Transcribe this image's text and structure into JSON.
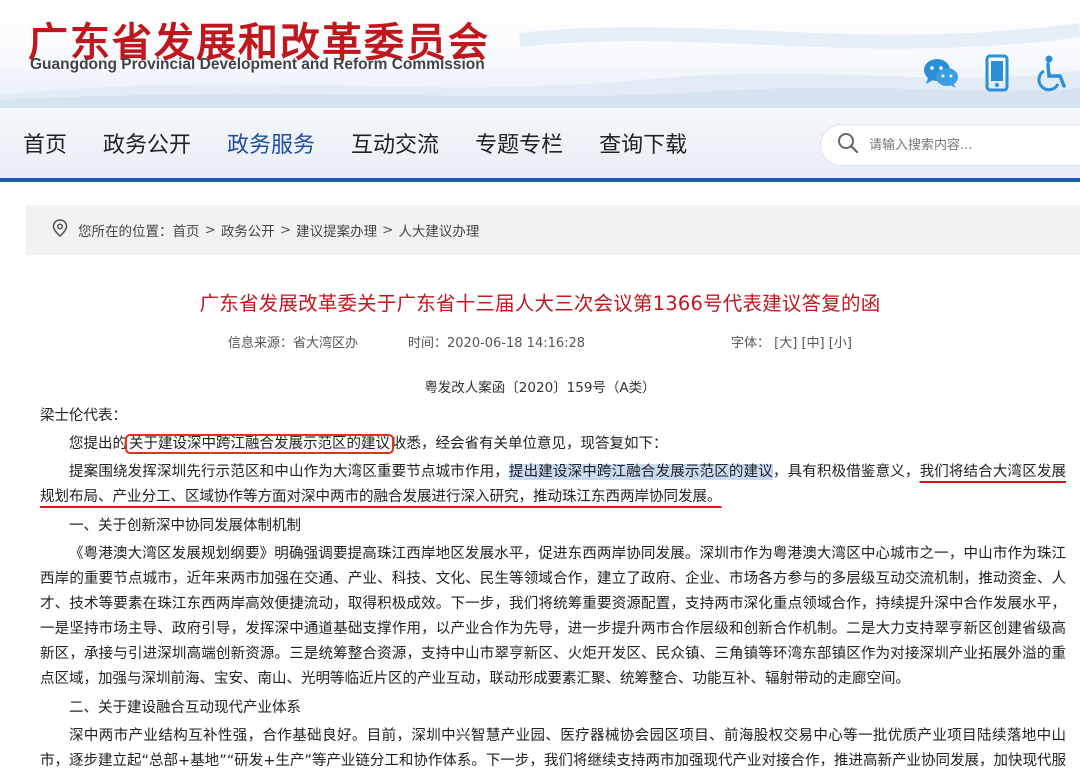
{
  "header": {
    "title": "广东省发展和改革委员会",
    "subtitle": "Guangdong Provincial Development and Reform Commission",
    "tools": [
      "wechat-icon",
      "mobile-icon",
      "accessibility-icon"
    ]
  },
  "nav": {
    "items": [
      {
        "label": "首页",
        "active": false
      },
      {
        "label": "政务公开",
        "active": false
      },
      {
        "label": "政务服务",
        "active": true
      },
      {
        "label": "互动交流",
        "active": false
      },
      {
        "label": "专题专栏",
        "active": false
      },
      {
        "label": "查询下载",
        "active": false
      }
    ],
    "search_placeholder": "请输入搜索内容..."
  },
  "breadcrumb": {
    "prefix": "您所在的位置：",
    "items": [
      "首页",
      "政务公开",
      "建议提案办理",
      "人大建议办理"
    ],
    "separator": ">"
  },
  "article": {
    "title": "广东省发展改革委关于广东省十三届人大三次会议第1366号代表建议答复的函",
    "source": "信息来源：省大湾区办",
    "time": "时间：2020-06-18 14:16:28",
    "font_label": "字体：",
    "font_sizes": [
      "[大]",
      "[中]",
      "[小]"
    ],
    "doc_no": "粤发改人案函〔2020〕159号（A类）",
    "salutation": "梁士伦代表：",
    "p1_before": "您提出的",
    "p1_boxed": "关于建设深中跨江融合发展示范区的建议",
    "p1_after": "收悉，经会省有关单位意见，现答复如下：",
    "p2_start": "提案围绕发挥深圳先行示范区和中山作为大湾区重要节点城市作用，",
    "p2_highlight": "提出建设深中跨江融合发展示范区的建议",
    "p2_mid": "，具有积极借鉴意义，",
    "p2_underlined": "我们将结合大湾区发展规划布局、产业分工、区域协作等方面对深中两市的融合发展进行深入研究，推动珠江东西两岸协同发展。",
    "section1": "一、关于创新深中协同发展体制机制",
    "p3": "《粤港澳大湾区发展规划纲要》明确强调要提高珠江西岸地区发展水平，促进东西两岸协同发展。深圳市作为粤港澳大湾区中心城市之一，中山市作为珠江西岸的重要节点城市，近年来两市加强在交通、产业、科技、文化、民生等领域合作，建立了政府、企业、市场各方参与的多层级互动交流机制，推动资金、人才、技术等要素在珠江东西两岸高效便捷流动，取得积极成效。下一步，我们将统筹重要资源配置，支持两市深化重点领域合作，持续提升深中合作发展水平，一是坚持市场主导、政府引导，发挥深中通道基础支撑作用，以产业合作为先导，进一步提升两市合作层级和创新合作机制。二是大力支持翠亨新区创建省级高新区，承接与引进深圳高端创新资源。三是统筹整合资源，支持中山市翠亨新区、火炬开发区、民众镇、三角镇等环湾东部镇区作为对接深圳产业拓展外溢的重点区域，加强与深圳前海、宝安、南山、光明等临近片区的产业互动，联动形成要素汇聚、统筹整合、功能互补、辐射带动的走廊空间。",
    "section2": "二、关于建设融合互动现代产业体系",
    "p4": "深中两市产业结构互补性强，合作基础良好。目前，深圳中兴智慧产业园、医疗器械协会园区项目、前海股权交易中心等一批优质产业项目陆续落地中山市，逐步建立起“总部+基地”“研发+生产”等产业链分工和协作体系。下一步，我们将继续支持两市加强现代产业对接合作，推进高新产业协同发展，加快现代服务业联动发展。一是加强深中科创资源对接合作，推动深圳市高新区与翠亨科学城合作，为珠江西岸科技创新水平提升提供支撑，共同推动科技创新成果孵化。"
  },
  "colors": {
    "brand_red": "#c0161d",
    "nav_blue": "#1f5aa8",
    "highlight": "#c8daf2",
    "annotation_red": "#e0301e"
  }
}
